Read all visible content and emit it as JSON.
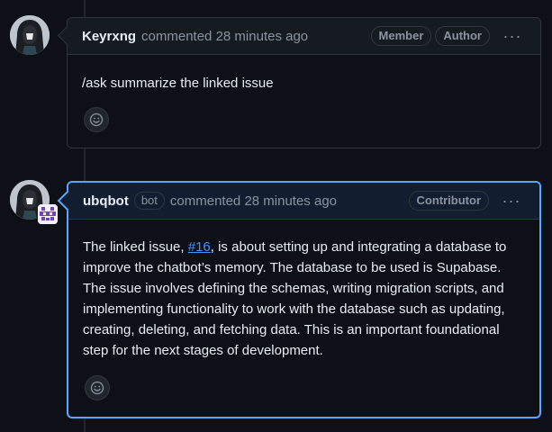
{
  "comments": [
    {
      "author": "Keyrxng",
      "action": "commented",
      "time": "28 minutes ago",
      "labels": [
        "Member",
        "Author"
      ],
      "body": "/ask summarize the linked issue",
      "avatar_icon": "hooded-figure-avatar",
      "reaction_icon": "smiley-icon"
    },
    {
      "author": "ubqbot",
      "bot_label": "bot",
      "action": "commented",
      "time": "28 minutes ago",
      "labels": [
        "Contributor"
      ],
      "body_prefix": "The linked issue, ",
      "issue_link": "#16",
      "body_suffix": ", is about setting up and integrating a database to improve the chatbot’s memory. The database to be used is Supabase. The issue involves defining the schemas, writing migration scripts, and implementing functionality to work with the database such as updating, creating, deleting, and fetching data. This is an important foundational step for the next stages of development.",
      "avatar_icon": "hooded-figure-avatar",
      "bot_avatar_icon": "pixel-bot-icon",
      "reaction_icon": "smiley-icon"
    }
  ],
  "kebab_label": "···",
  "colors": {
    "background": "#0d1117",
    "border": "#30363d",
    "highlight_border": "#58a6ff",
    "link": "#4493f8",
    "muted_text": "#8b949e",
    "bot_avatar_purple": "#6f42c1"
  }
}
